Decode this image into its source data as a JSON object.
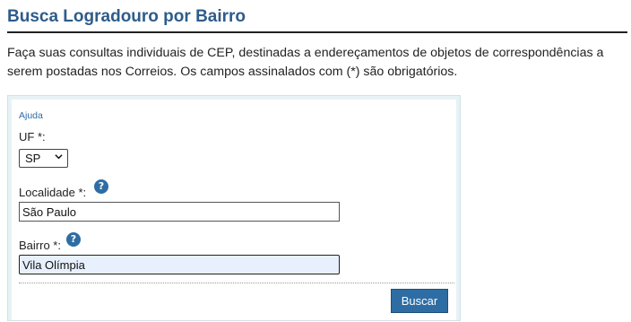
{
  "header": {
    "title": "Busca Logradouro por Bairro"
  },
  "intro": {
    "text": "Faça suas consultas individuais de CEP, destinadas a endereçamentos de objetos de correspondências a serem postadas nos Correios. Os campos assinalados com (*) são obrigatórios."
  },
  "form": {
    "help_link": "Ajuda",
    "uf": {
      "label": "UF *:",
      "selected": "SP"
    },
    "localidade": {
      "label": "Localidade *:",
      "value": "São Paulo"
    },
    "bairro": {
      "label": "Bairro *:",
      "value": "Vila Olímpia"
    },
    "help_icon_glyph": "?",
    "submit_label": "Buscar"
  },
  "colors": {
    "title": "#2e5c8a",
    "accent": "#2e6da4",
    "form_border": "#e6f2f4",
    "focused_input": "#e8f0fe"
  },
  "icons": [
    "help-icon",
    "chevron-down-icon"
  ]
}
